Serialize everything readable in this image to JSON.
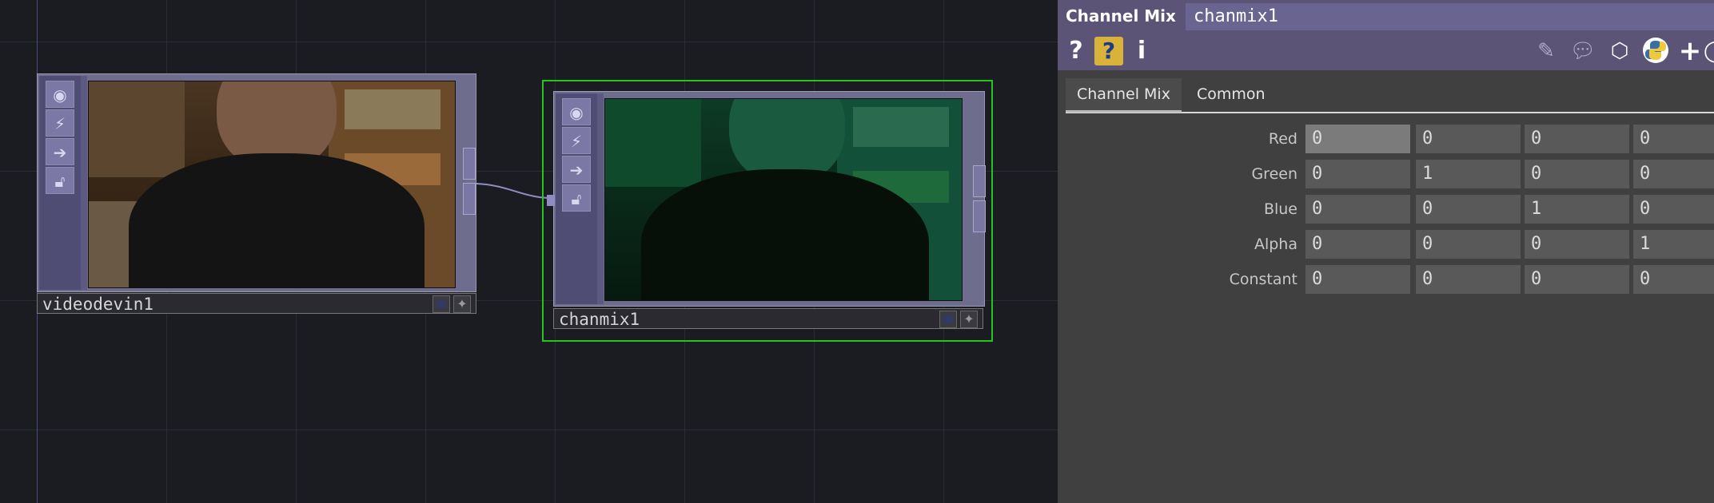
{
  "network": {
    "nodes": [
      {
        "name": "videodevin1"
      },
      {
        "name": "chanmix1"
      }
    ]
  },
  "params": {
    "op_type": "Channel Mix",
    "op_name": "chanmix1",
    "toolbar": {
      "help": "?",
      "info": "i",
      "add": "+"
    },
    "tabs": [
      "Channel Mix",
      "Common"
    ],
    "rows": [
      {
        "label": "Red",
        "values": [
          "0",
          "0",
          "0",
          "0"
        ]
      },
      {
        "label": "Green",
        "values": [
          "0",
          "1",
          "0",
          "0"
        ]
      },
      {
        "label": "Blue",
        "values": [
          "0",
          "0",
          "1",
          "0"
        ]
      },
      {
        "label": "Alpha",
        "values": [
          "0",
          "0",
          "0",
          "1"
        ]
      },
      {
        "label": "Constant",
        "values": [
          "0",
          "0",
          "0",
          "0"
        ]
      }
    ]
  },
  "colors": {
    "selected_outline": "#22c522",
    "header": "#5b5477",
    "node_body": "#6f6d8e"
  }
}
